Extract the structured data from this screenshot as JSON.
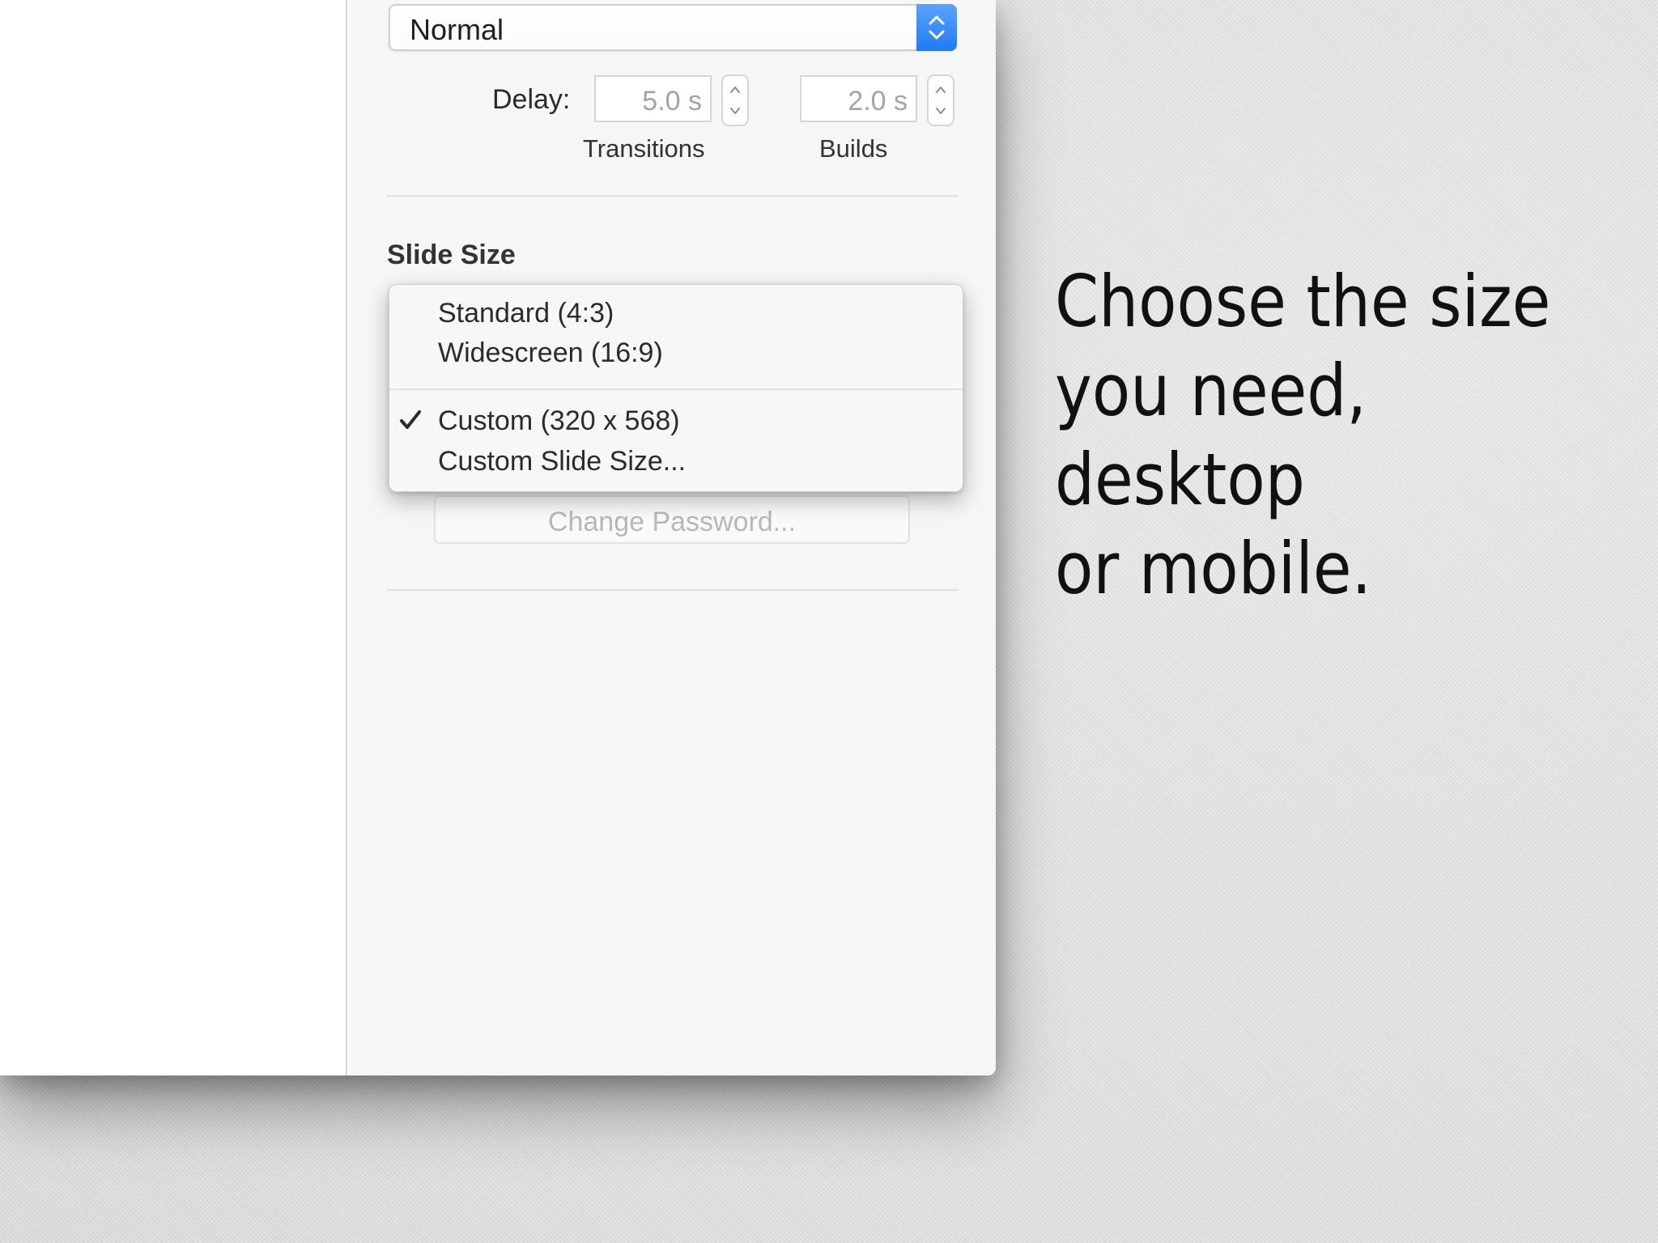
{
  "inspector": {
    "popup": {
      "value": "Normal"
    },
    "delay": {
      "label": "Delay:",
      "transitions_value": "5.0 s",
      "transitions_label": "Transitions",
      "builds_value": "2.0 s",
      "builds_label": "Builds"
    },
    "slide_size": {
      "title": "Slide Size",
      "menu": {
        "items": [
          "Standard (4:3)",
          "Widescreen (16:9)",
          "Custom (320 x 568)",
          "Custom Slide Size..."
        ],
        "checkmark": "✓"
      }
    },
    "change_password": {
      "label": "Change Password..."
    }
  },
  "caption": {
    "text": "Choose the size\nyou need, desktop\nor mobile."
  },
  "colors": {
    "accent": "#2a83f5",
    "background": "#dedede",
    "panel": "#f6f6f6"
  },
  "icons": {
    "popup_arrows": "chevron-updown-icon",
    "stepper": "stepper-arrows-icon",
    "check": "checkmark-icon"
  }
}
